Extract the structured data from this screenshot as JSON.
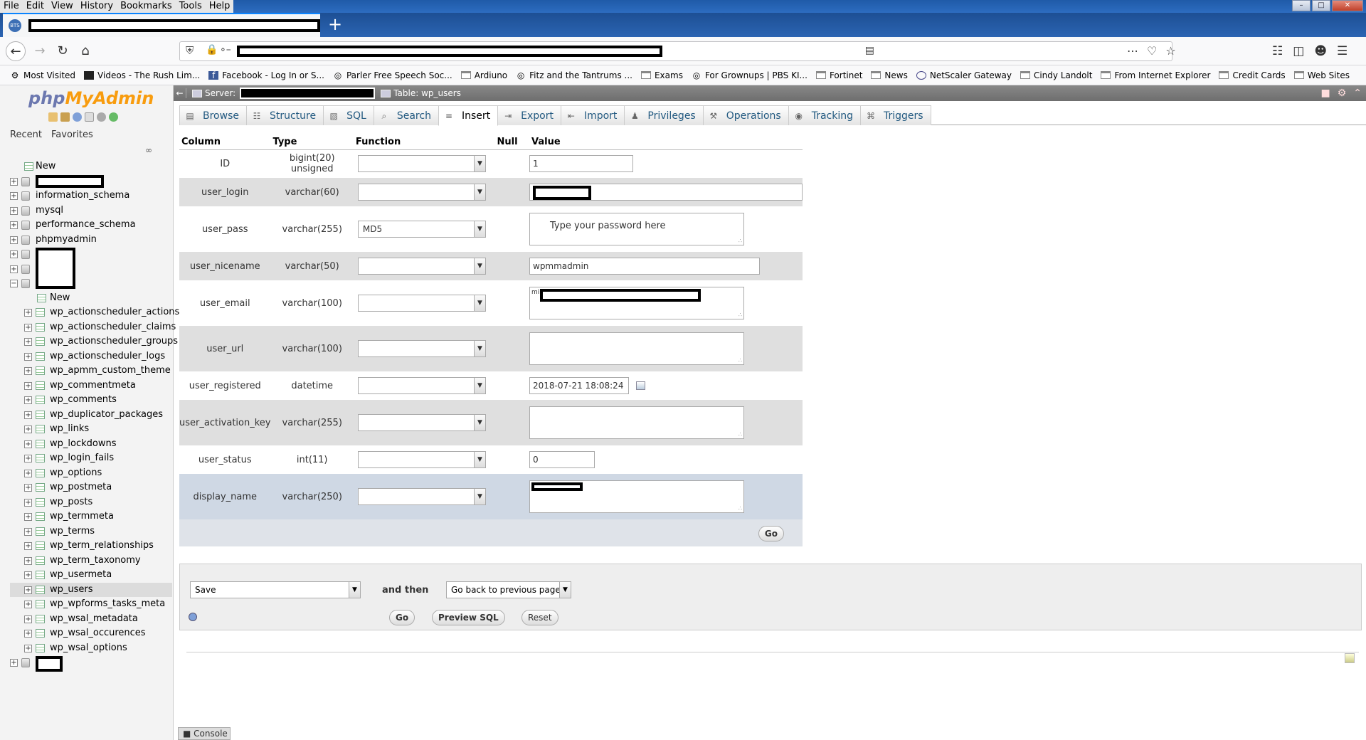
{
  "browser": {
    "menu": [
      "File",
      "Edit",
      "View",
      "History",
      "Bookmarks",
      "Tools",
      "Help"
    ],
    "tab_favicon_text": "BTS",
    "new_tab_symbol": "+",
    "bookmarks": [
      {
        "label": "Most Visited",
        "icon": "gear-icon"
      },
      {
        "label": "Videos - The Rush Lim...",
        "icon": "rush-icon"
      },
      {
        "label": "Facebook - Log In or S...",
        "icon": "facebook-icon"
      },
      {
        "label": "Parler Free Speech Soc...",
        "icon": "globe-icon"
      },
      {
        "label": "Ardiuno",
        "icon": "folder-icon"
      },
      {
        "label": "Fitz and the Tantrums ...",
        "icon": "globe-icon"
      },
      {
        "label": "Exams",
        "icon": "folder-icon"
      },
      {
        "label": "For Grownups | PBS KI...",
        "icon": "globe-icon"
      },
      {
        "label": "Fortinet",
        "icon": "folder-icon"
      },
      {
        "label": "News",
        "icon": "folder-icon"
      },
      {
        "label": "NetScaler Gateway",
        "icon": "netscaler-icon"
      },
      {
        "label": "Cindy Landolt",
        "icon": "folder-icon"
      },
      {
        "label": "From Internet Explorer",
        "icon": "folder-icon"
      },
      {
        "label": "Credit Cards",
        "icon": "folder-icon"
      },
      {
        "label": "Web Sites",
        "icon": "folder-icon"
      }
    ]
  },
  "pma": {
    "logo_php": "php",
    "logo_myadmin": "MyAdmin",
    "recent": "Recent",
    "favorites": "Favorites",
    "tree_new": "New",
    "databases": [
      "information_schema",
      "mysql",
      "performance_schema",
      "phpmyadmin"
    ],
    "tables": [
      "New",
      "wp_actionscheduler_actions",
      "wp_actionscheduler_claims",
      "wp_actionscheduler_groups",
      "wp_actionscheduler_logs",
      "wp_apmm_custom_theme",
      "wp_commentmeta",
      "wp_comments",
      "wp_duplicator_packages",
      "wp_links",
      "wp_lockdowns",
      "wp_login_fails",
      "wp_options",
      "wp_postmeta",
      "wp_posts",
      "wp_termmeta",
      "wp_terms",
      "wp_term_relationships",
      "wp_term_taxonomy",
      "wp_usermeta",
      "wp_users",
      "wp_wpforms_tasks_meta",
      "wp_wsal_metadata",
      "wp_wsal_occurences",
      "wp_wsal_options"
    ],
    "selected_table": "wp_users",
    "breadcrumb_server": "Server:",
    "breadcrumb_table": "Table: wp_users",
    "tabs": [
      {
        "label": "Browse",
        "icon": "browse-icon"
      },
      {
        "label": "Structure",
        "icon": "structure-icon"
      },
      {
        "label": "SQL",
        "icon": "sql-icon"
      },
      {
        "label": "Search",
        "icon": "search-icon"
      },
      {
        "label": "Insert",
        "icon": "insert-icon"
      },
      {
        "label": "Export",
        "icon": "export-icon"
      },
      {
        "label": "Import",
        "icon": "import-icon"
      },
      {
        "label": "Privileges",
        "icon": "privileges-icon"
      },
      {
        "label": "Operations",
        "icon": "operations-icon"
      },
      {
        "label": "Tracking",
        "icon": "tracking-icon"
      },
      {
        "label": "Triggers",
        "icon": "triggers-icon"
      }
    ],
    "active_tab": "Insert",
    "headers": {
      "column": "Column",
      "type": "Type",
      "function": "Function",
      "null": "Null",
      "value": "Value"
    },
    "rows": [
      {
        "column": "ID",
        "type": "bigint(20) unsigned",
        "function": "",
        "value": "1"
      },
      {
        "column": "user_login",
        "type": "varchar(60)",
        "function": "",
        "value": ""
      },
      {
        "column": "user_pass",
        "type": "varchar(255)",
        "function": "MD5",
        "value": "Type your password here"
      },
      {
        "column": "user_nicename",
        "type": "varchar(50)",
        "function": "",
        "value": "wpmmadmin"
      },
      {
        "column": "user_email",
        "type": "varchar(100)",
        "function": "",
        "value": "mi"
      },
      {
        "column": "user_url",
        "type": "varchar(100)",
        "function": "",
        "value": ""
      },
      {
        "column": "user_registered",
        "type": "datetime",
        "function": "",
        "value": "2018-07-21 18:08:24"
      },
      {
        "column": "user_activation_key",
        "type": "varchar(255)",
        "function": "",
        "value": ""
      },
      {
        "column": "user_status",
        "type": "int(11)",
        "function": "",
        "value": "0"
      },
      {
        "column": "display_name",
        "type": "varchar(250)",
        "function": "",
        "value": ""
      }
    ],
    "go": "Go",
    "after": {
      "action": "Save",
      "and_then": "and then",
      "next": "Go back to previous page",
      "go": "Go",
      "preview": "Preview SQL",
      "reset": "Reset"
    },
    "console": "Console"
  }
}
